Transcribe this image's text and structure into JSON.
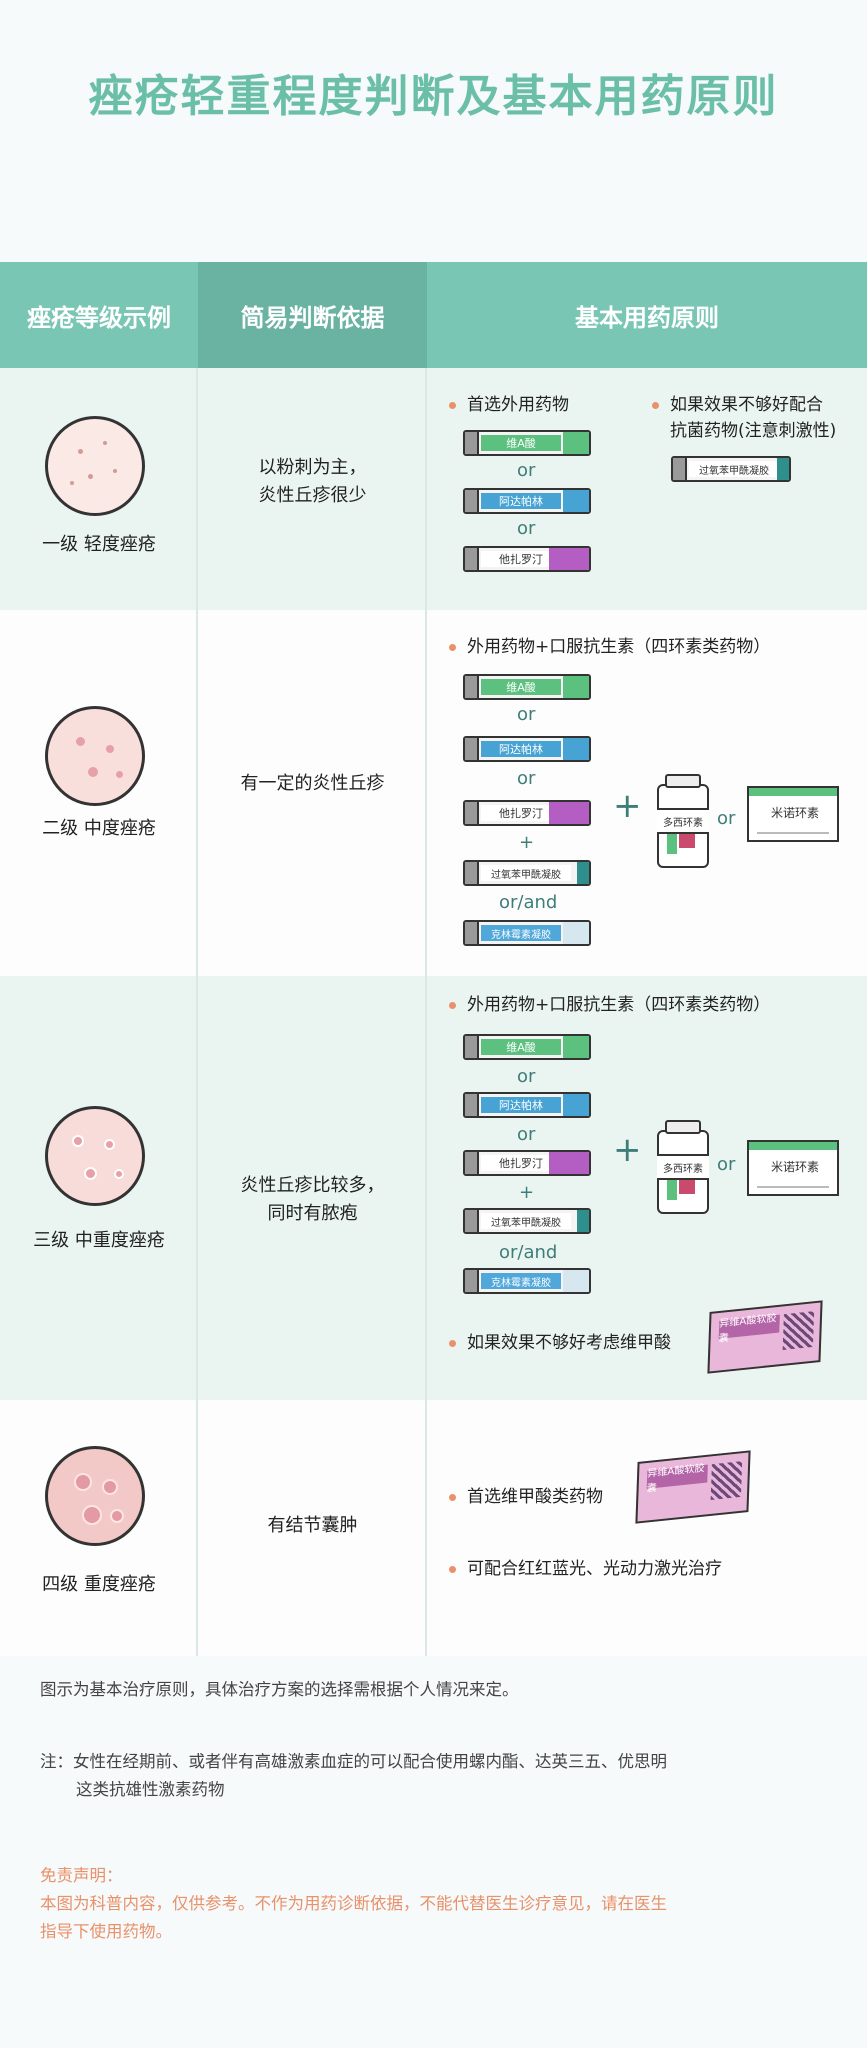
{
  "title": "痤疮轻重程度判断及基本用药原则",
  "header": {
    "col1": "痤疮等级示例",
    "col2": "简易判断依据",
    "col3": "基本用药原则"
  },
  "rows": [
    {
      "grade": "一级 轻度痤疮",
      "basis_line1": "以粉刺为主，",
      "basis_line2": "炎性丘疹很少",
      "bullet1": "首选外用药物",
      "bullet2_line1": "如果效果不够好配合",
      "bullet2_line2": "抗菌药物(注意刺激性)",
      "tubes": [
        "维A酸",
        "阿达帕林",
        "他扎罗汀",
        "过氧苯甲酰凝胶"
      ],
      "or": "or"
    },
    {
      "grade": "二级 中度痤疮",
      "basis_line1": "有一定的炎性丘疹",
      "bullet1": "外用药物+口服抗生素（四环素类药物）",
      "tubes": [
        "维A酸",
        "阿达帕林",
        "他扎罗汀",
        "过氧苯甲酰凝胶",
        "克林霉素凝胶"
      ],
      "or": "or",
      "plus": "+",
      "or_and": "or/and",
      "bottle": "多西环素",
      "box": "米诺环素"
    },
    {
      "grade": "三级 中重度痤疮",
      "basis_line1": "炎性丘疹比较多，",
      "basis_line2": "同时有脓疱",
      "bullet1": "外用药物+口服抗生素（四环素类药物）",
      "bullet2": "如果效果不够好考虑维甲酸",
      "tubes": [
        "维A酸",
        "阿达帕林",
        "他扎罗汀",
        "过氧苯甲酰凝胶",
        "克林霉素凝胶"
      ],
      "or": "or",
      "plus": "+",
      "or_and": "or/and",
      "bottle": "多西环素",
      "box": "米诺环素",
      "pink_box": "异维A酸软胶囊"
    },
    {
      "grade": "四级 重度痤疮",
      "basis_line1": "有结节囊肿",
      "bullet1": "首选维甲酸类药物",
      "bullet2": "可配合红红蓝光、光动力激光治疗",
      "pink_box": "异维A酸软胶囊"
    }
  ],
  "notes": {
    "note1": "图示为基本治疗原则，具体治疗方案的选择需根据个人情况来定。",
    "note2_line1": "注：女性在经期前、或者伴有高雄激素血症的可以配合使用螺内酯、达英三五、优思明",
    "note2_line2": "这类抗雄性激素药物",
    "disclaimer_title": "免责声明：",
    "disclaimer_line1": "本图为科普内容，仅供参考。不作为用药诊断依据，不能代替医生诊疗意见，请在医生",
    "disclaimer_line2": "指导下使用药物。"
  },
  "colors": {
    "title": "#6bbfa8",
    "header_bg": "#7ac6b4",
    "accent_orange": "#e8916a"
  }
}
